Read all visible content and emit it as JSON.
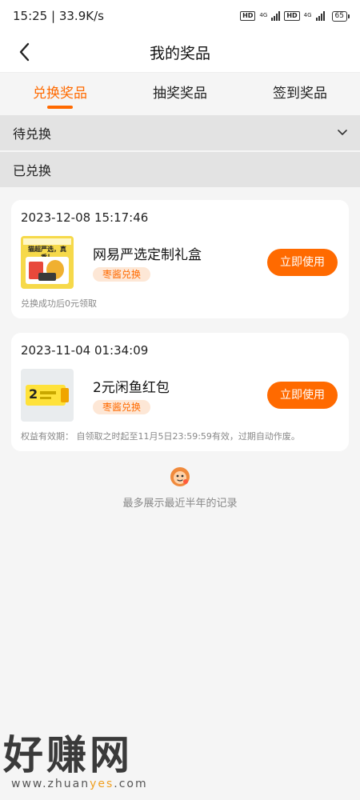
{
  "status_bar": {
    "time": "15:25",
    "net_speed": "33.9K/s",
    "hd1": "HD",
    "net1": "4G",
    "hd2": "HD",
    "net2": "4G",
    "battery": "65"
  },
  "header": {
    "title": "我的奖品"
  },
  "tabs": [
    {
      "label": "兑换奖品",
      "active": true
    },
    {
      "label": "抽奖奖品",
      "active": false
    },
    {
      "label": "签到奖品",
      "active": false
    }
  ],
  "sections": {
    "pending": "待兑换",
    "redeemed": "已兑换"
  },
  "records": [
    {
      "date": "2023-12-08 15:17:46",
      "name": "网易严选定制礼盒",
      "tag": "枣酱兑换",
      "button": "立即使用",
      "note": "兑换成功后0元领取",
      "thumb_text": "猫超严选，真香！"
    },
    {
      "date": "2023-11-04 01:34:09",
      "name": "2元闲鱼红包",
      "tag": "枣酱兑换",
      "button": "立即使用",
      "note": "权益有效期：  自领取之时起至11月5日23:59:59有效，过期自动作废。",
      "thumb_text": "2"
    }
  ],
  "footer": {
    "text": "最多展示最近半年的记录"
  },
  "watermark": {
    "big": "好赚网",
    "small_a": "www.zhuan",
    "small_b": "yes",
    "small_c": ".com"
  },
  "colors": {
    "accent": "#ff6a00",
    "tag_bg": "#fde7d6",
    "page_bg": "#f5f5f5"
  }
}
